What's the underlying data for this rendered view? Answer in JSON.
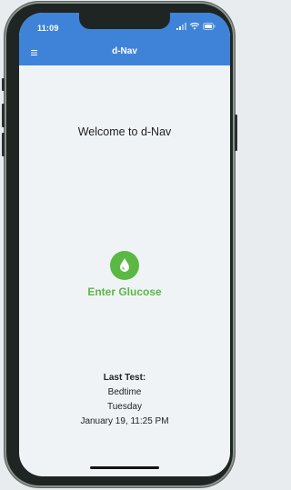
{
  "status_bar": {
    "time": "11:09",
    "icons": [
      "signal-icon",
      "wifi-icon",
      "battery-icon"
    ]
  },
  "nav_bar": {
    "title": "d-Nav",
    "menu_icon": "menu-icon"
  },
  "main": {
    "welcome": "Welcome to d-Nav",
    "enter_glucose_label": "Enter Glucose",
    "enter_glucose_icon": "water-drop-icon"
  },
  "last_test": {
    "title": "Last Test:",
    "period": "Bedtime",
    "day": "Tuesday",
    "datetime": "January 19, 11:25 PM"
  },
  "colors": {
    "header_blue": "#3f83d8",
    "accent_green": "#5bb844",
    "background": "#f0f3f6"
  }
}
